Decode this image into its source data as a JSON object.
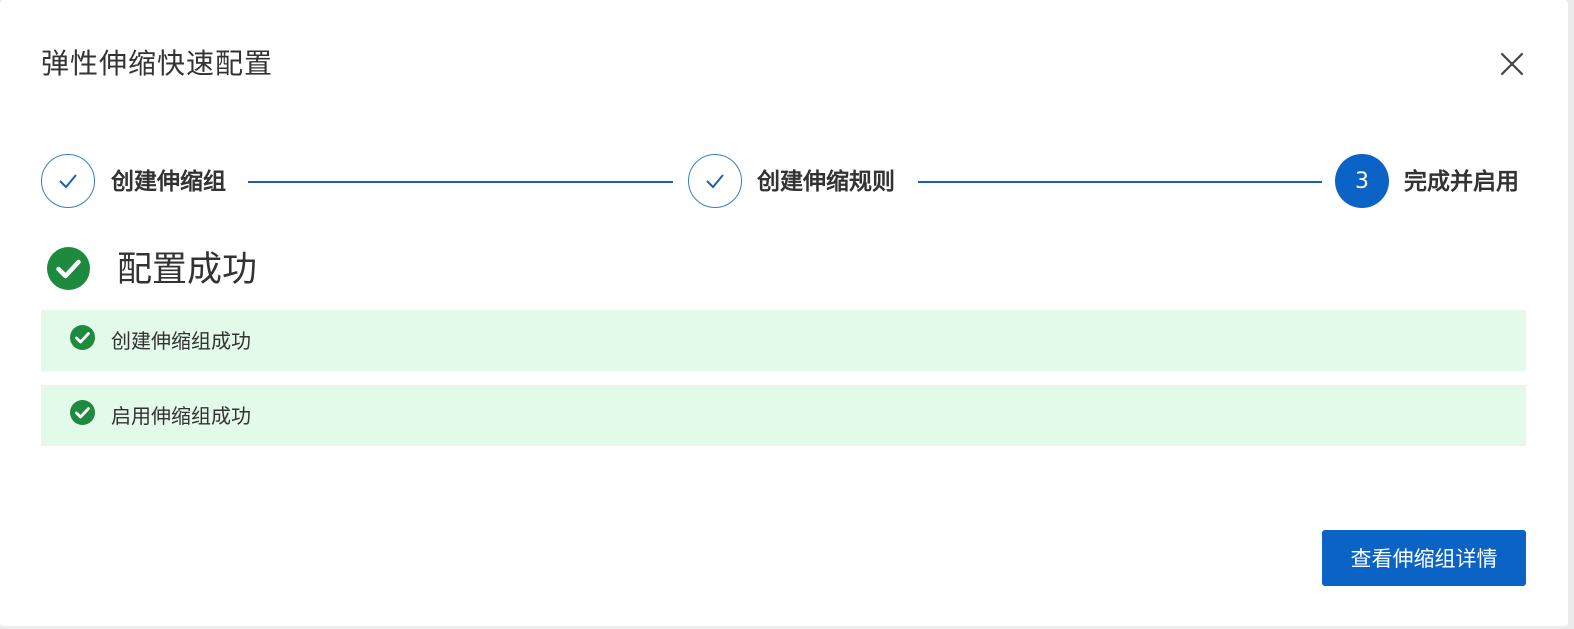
{
  "dialog": {
    "title": "弹性伸缩快速配置",
    "close_icon": "close-icon"
  },
  "steps": [
    {
      "label": "创建伸缩组",
      "status": "done",
      "icon": "check-icon"
    },
    {
      "label": "创建伸缩规则",
      "status": "done",
      "icon": "check-icon"
    },
    {
      "label": "完成并启用",
      "status": "active",
      "number": "3"
    }
  ],
  "result": {
    "title": "配置成功",
    "icon": "success-check-icon",
    "items": [
      {
        "text": "创建伸缩组成功",
        "icon": "success-check-icon"
      },
      {
        "text": "启用伸缩组成功",
        "icon": "success-check-icon"
      }
    ]
  },
  "footer": {
    "primary_button_label": "查看伸缩组详情"
  },
  "colors": {
    "accent": "#0b63c5",
    "success": "#1e8a3e",
    "success_bg": "#e3faea",
    "text": "#333333"
  }
}
